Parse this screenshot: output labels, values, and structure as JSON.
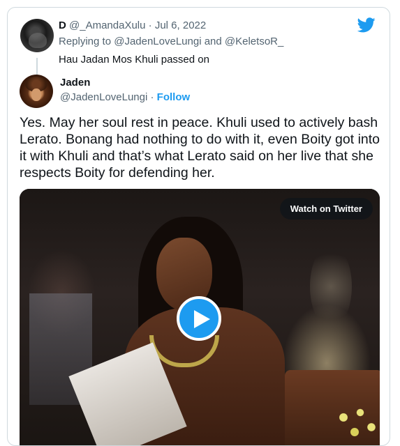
{
  "parent_tweet": {
    "display_name": "D",
    "handle": "@_AmandaXulu",
    "separator": "·",
    "date": "Jul 6, 2022",
    "replying_to": "Replying to @JadenLoveLungi and @KeletsoR_",
    "text": "Hau Jadan Mos Khuli passed on"
  },
  "main_tweet": {
    "display_name": "Jaden",
    "handle": "@JadenLoveLungi",
    "separator": "·",
    "follow_label": "Follow",
    "body": "Yes. May her soul rest in peace. Khuli used to actively bash Lerato. Bonang had nothing to do with it, even Boity got into it with Khuli and that’s what Lerato said on her live that she respects Boity for defending her."
  },
  "video": {
    "watch_label": "Watch on Twitter",
    "play_icon": "play-icon"
  },
  "icons": {
    "logo": "twitter-bird-icon"
  },
  "colors": {
    "accent": "#1d9bf0",
    "text": "#0f1419",
    "muted": "#536471",
    "border": "#cfd9de"
  }
}
